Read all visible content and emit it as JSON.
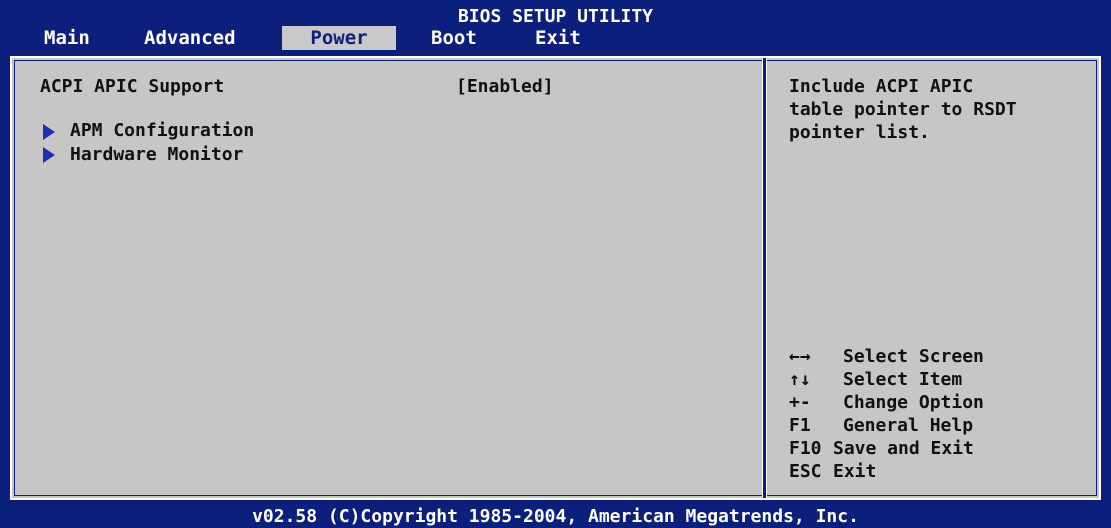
{
  "title": "BIOS SETUP UTILITY",
  "tabs": [
    {
      "label": "Main"
    },
    {
      "label": "Advanced"
    },
    {
      "label": "Power"
    },
    {
      "label": "Boot"
    },
    {
      "label": "Exit"
    }
  ],
  "active_tab": "Power",
  "settings": {
    "acpi_apic": {
      "label": "ACPI APIC Support",
      "value": "[Enabled]"
    }
  },
  "submenus": [
    {
      "label": "APM Configuration"
    },
    {
      "label": "Hardware Monitor"
    }
  ],
  "help": {
    "lines": [
      "Include ACPI APIC",
      "table pointer to RSDT",
      "pointer list."
    ]
  },
  "keys": [
    {
      "key": "←→",
      "action": "Select Screen"
    },
    {
      "key": "↑↓",
      "action": "Select Item"
    },
    {
      "key": "+-",
      "action": "Change Option"
    },
    {
      "key": "F1",
      "action": "General Help"
    },
    {
      "key": "F10",
      "action": "Save and Exit"
    },
    {
      "key": "ESC",
      "action": "Exit"
    }
  ],
  "footer": "v02.58 (C)Copyright 1985-2004, American Megatrends, Inc.",
  "colors": {
    "background": "#0d1f7d",
    "panel": "#c6c6c6",
    "text": "#111111",
    "active_tab_text": "#0d1f7d",
    "arrow": "#1c2fb0"
  }
}
